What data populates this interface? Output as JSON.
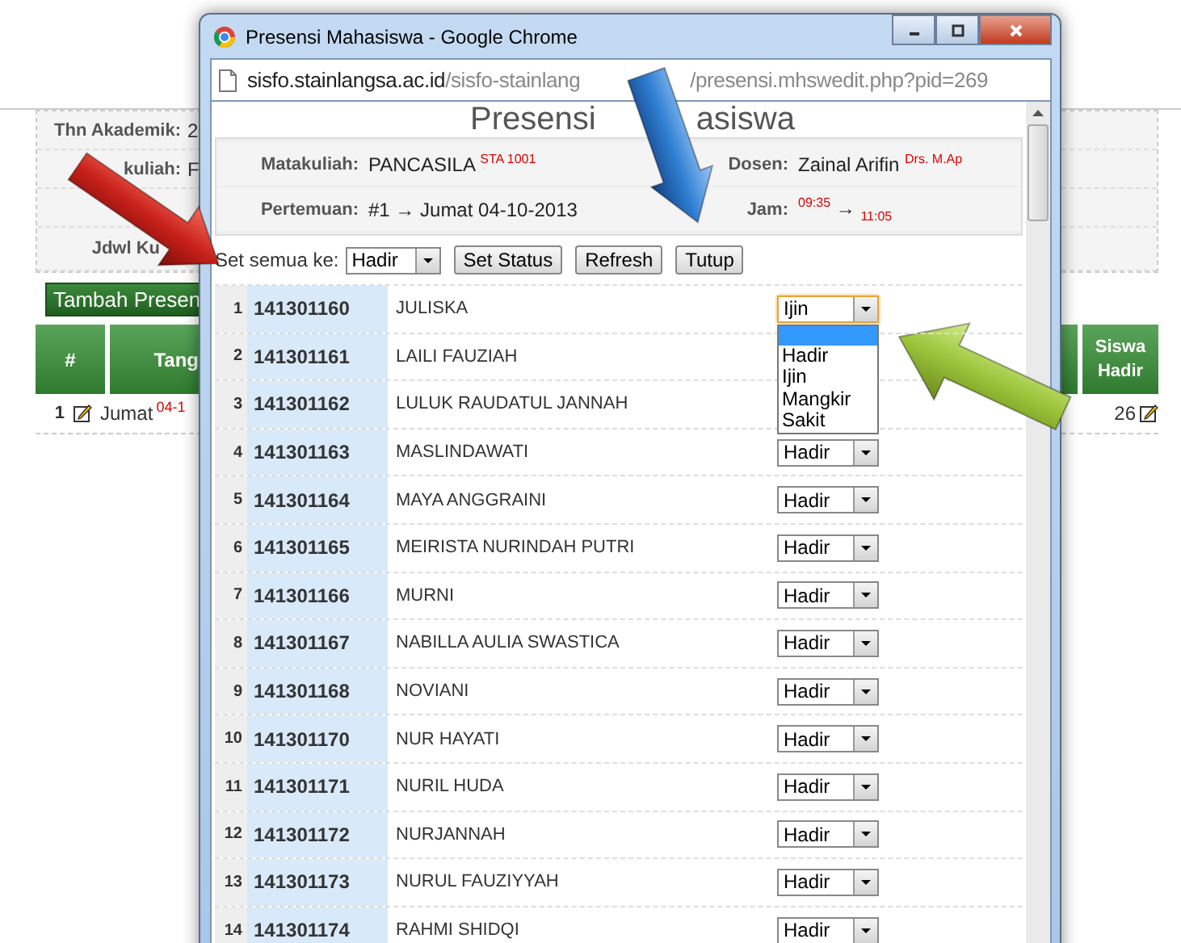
{
  "background_page": {
    "info_rows": [
      {
        "label": "Thn Akademik:",
        "value": "2"
      },
      {
        "label": "kuliah:",
        "value": "F"
      }
    ],
    "schedule_label": "Jdwl Ku",
    "add_button": "Tambah Presen",
    "columns": [
      "#",
      "Tang"
    ],
    "row": {
      "no": "1",
      "day": "Jumat",
      "date": "04-1"
    },
    "right_column": "Siswa Hadir",
    "right_value": "26"
  },
  "browser_window": {
    "title": "Presensi Mahasiswa - Google Chrome",
    "url_host": "sisfo.stainlangsa.ac.id",
    "url_path": "/sisfo-stainlang",
    "url_rest": "/presensi.mhswedit.php?pid=269"
  },
  "page": {
    "title_start": "Presensi",
    "title_end": "asiswa",
    "course_label": "Matakuliah:",
    "course": "PANCASILA $^{STA 1001}$",
    "lecturer_label": "Dosen:",
    "lecturer": "Zainal Arifin $^{Drs. M.Ap}$",
    "meeting_label": "Pertemuan:",
    "meeting": "#1 → Jumat 04-10-2013",
    "time_label": "Jam:",
    "time": "$^{09:35}$ → $_{11:05}$",
    "set_all_label": "Set semua ke:",
    "set_all_value": "Hadir",
    "buttons": [
      "Set Status",
      "Refresh",
      "Tutup"
    ],
    "students": [
      {
        "no": "1",
        "nim": "141301160",
        "name": "JULISKA",
        "status": "Ijin",
        "focused": true
      },
      {
        "no": "2",
        "nim": "141301161",
        "name": "LAILI FAUZIAH",
        "focused": false
      },
      {
        "no": "3",
        "nim": "141301162",
        "name": "LULUK RAUDATUL JANNAH",
        "focused": false
      },
      {
        "no": "4",
        "nim": "141301163",
        "name": "MASLINDAWATI",
        "status": "Hadir",
        "focused": false
      },
      {
        "no": "5",
        "nim": "141301164",
        "name": "MAYA ANGGRAINI",
        "status": "Hadir",
        "focused": false
      },
      {
        "no": "6",
        "nim": "141301165",
        "name": "MEIRISTA NURINDAH PUTRI",
        "status": "Hadir",
        "focused": false
      },
      {
        "no": "7",
        "nim": "141301166",
        "name": "MURNI",
        "status": "Hadir",
        "focused": false
      },
      {
        "no": "8",
        "nim": "141301167",
        "name": "NABILLA AULIA SWASTICA",
        "status": "Hadir",
        "focused": false
      },
      {
        "no": "9",
        "nim": "141301168",
        "name": "NOVIANI",
        "status": "Hadir",
        "focused": false
      },
      {
        "no": "10",
        "nim": "141301170",
        "name": "NUR HAYATI",
        "status": "Hadir",
        "focused": false
      },
      {
        "no": "11",
        "nim": "141301171",
        "name": "NURIL HUDA",
        "status": "Hadir",
        "focused": false
      },
      {
        "no": "12",
        "nim": "141301172",
        "name": "NURJANNAH",
        "status": "Hadir",
        "focused": false
      },
      {
        "no": "13",
        "nim": "141301173",
        "name": "NURUL FAUZIYYAH",
        "status": "Hadir",
        "focused": false
      },
      {
        "no": "14",
        "nim": "141301174",
        "name": "RAHMI SHIDQI",
        "status": "Hadir",
        "focused": false
      }
    ],
    "dropdown": {
      "blank_selected": true,
      "options": [
        "Hadir",
        "Ijin",
        "Mangkir",
        "Sakit"
      ]
    }
  }
}
